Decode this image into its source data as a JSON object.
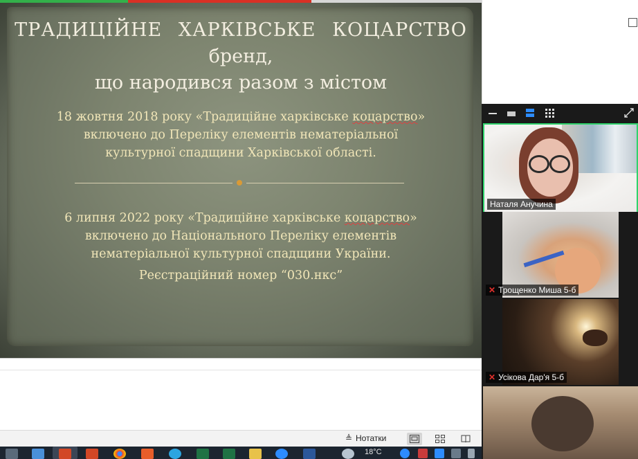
{
  "slide": {
    "title_line1": "ТРАДИЦІЙНЕ  ХАРКІВСЬКЕ  КОЦАРСТВО",
    "title_line2": "бренд,",
    "title_line3": "що народився разом з містом",
    "para1": {
      "line1_pre": "18 жовтня 2018 року «Традиційне харківське ",
      "line1_word": "коцарство",
      "line1_post": "»",
      "line2": "включено до Переліку елементів нематеріальної",
      "line3": "культурної спадщини Харківської області."
    },
    "para2": {
      "line1_pre": "6 липня 2022 року «Традиційне харківське ",
      "line1_word": "коцарство",
      "line1_post": "»",
      "line2": "включено до Національного Переліку елементів",
      "line3": "нематеріальної культурної спадщини України."
    },
    "registration": "Реєстраційний номер “030.нкс”"
  },
  "statusbar": {
    "notes_label": "Нотатки"
  },
  "taskbar": {
    "temperature": "18°C"
  },
  "meeting": {
    "participants": [
      {
        "name": "Наталя Анучина",
        "muted": false
      },
      {
        "name": "Трощенко Миша 5-б",
        "muted": true
      },
      {
        "name": "Усікова Дар'я 5-б",
        "muted": true
      },
      {
        "name": "",
        "muted": false
      }
    ]
  },
  "colors": {
    "slide_title": "#f3eee0",
    "slide_text": "#f1e6b8",
    "active_speaker_border": "#2ed36b",
    "muted_icon": "#e0302c"
  }
}
